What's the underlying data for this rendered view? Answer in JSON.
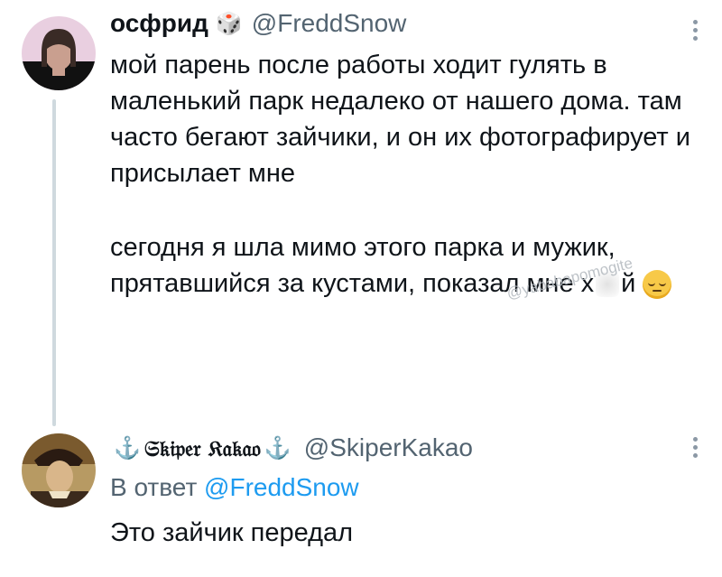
{
  "tweet1": {
    "display_name": "осфрид",
    "name_emoji": "🎲",
    "handle": "@FreddSnow",
    "paragraph1": "мой парень после работы ходит гулять в маленький парк недалеко от нашего дома. там часто бегают зайчики, и он их фотографирует и присылает мне",
    "paragraph2_start": "сегодня я шла мимо этого парка и мужик, прятавшийся за кустами, показал мне х",
    "paragraph2_end": "й"
  },
  "watermark": "@yababapomogite",
  "tweet2": {
    "display_name": "𝔖𝔨𝔦𝔭𝔢𝔯 𝔎𝔞𝔨𝔞𝔬",
    "anchor_left": "⚓",
    "anchor_right": "⚓",
    "handle": "@SkiperKakao",
    "reply_prefix": "В ответ",
    "reply_to": "@FreddSnow",
    "text": "Это зайчик передал"
  },
  "colors": {
    "text": "#0f1419",
    "secondary": "#536471",
    "link": "#1d9bf0",
    "thread_line": "#cfd9de"
  },
  "icons": {
    "tweet1_avatar": "avatar-woman-photo",
    "tweet2_avatar": "avatar-medieval-portrait",
    "more": "more-vertical-icon",
    "pensive_emoji": "pensive-face-emoji"
  }
}
